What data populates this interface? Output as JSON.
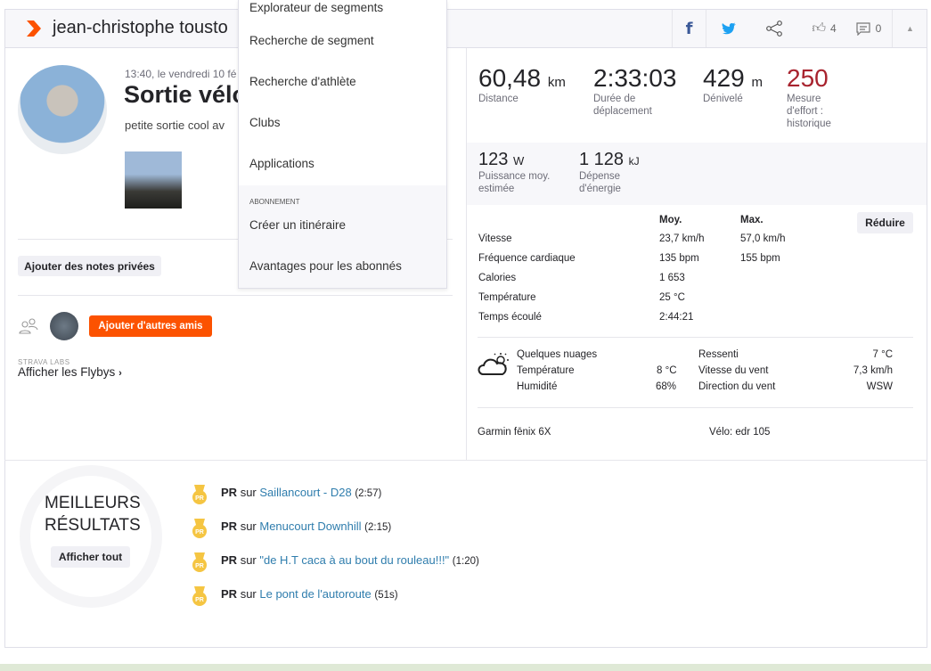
{
  "header": {
    "athlete_name": "jean-christophe tousto",
    "likes": "4",
    "comments": "0"
  },
  "menu": {
    "items": [
      "Explorateur de segments",
      "Recherche de segment",
      "Recherche d'athlète",
      "Clubs",
      "Applications"
    ],
    "section_label": "ABONNEMENT",
    "sub_items": [
      "Créer un itinéraire",
      "Avantages pour les abonnés"
    ]
  },
  "activity": {
    "datetime": "13:40, le vendredi 10 fé",
    "title": "Sortie vélo",
    "description": "petite sortie cool av",
    "private_notes_button": "Ajouter des notes privées",
    "add_friends_button": "Ajouter d'autres amis",
    "labs_label": "STRAVA LABS",
    "flybys_link": "Afficher les Flybys"
  },
  "stats": {
    "primary": [
      {
        "value": "60,48",
        "unit": "km",
        "label": "Distance"
      },
      {
        "value": "2:33:03",
        "unit": "",
        "label": "Durée de déplacement"
      },
      {
        "value": "429",
        "unit": "m",
        "label": "Dénivelé"
      },
      {
        "value": "250",
        "unit": "",
        "label": "Mesure d'effort : historique"
      }
    ],
    "secondary": [
      {
        "value": "123",
        "unit": "W",
        "label": "Puissance moy. estimée"
      },
      {
        "value": "1 128",
        "unit": "kJ",
        "label": "Dépense d'énergie"
      }
    ],
    "table_headers": [
      "Moy.",
      "Max."
    ],
    "reduce_button": "Réduire",
    "rows": [
      {
        "label": "Vitesse",
        "avg": "23,7 km/h",
        "max": "57,0 km/h"
      },
      {
        "label": "Fréquence cardiaque",
        "avg": "135 bpm",
        "max": "155 bpm"
      },
      {
        "label": "Calories",
        "avg": "1 653",
        "max": ""
      },
      {
        "label": "Température",
        "avg": "25 °C",
        "max": ""
      },
      {
        "label": "Temps écoulé",
        "avg": "2:44:21",
        "max": ""
      }
    ]
  },
  "weather": {
    "condition": "Quelques nuages",
    "temp_label": "Température",
    "temp": "8 °C",
    "humidity_label": "Humidité",
    "humidity": "68%",
    "feels_label": "Ressenti",
    "feels": "7 °C",
    "wind_speed_label": "Vitesse du vent",
    "wind_speed": "7,3 km/h",
    "wind_dir_label": "Direction du vent",
    "wind_dir": "WSW"
  },
  "device": {
    "device": "Garmin fēnix 6X",
    "bike": "Vélo: edr 105"
  },
  "results": {
    "title_1": "MEILLEURS",
    "title_2": "RÉSULTATS",
    "show_all": "Afficher tout",
    "pr_label": "PR",
    "sur": "sur",
    "items": [
      {
        "segment": "Saillancourt - D28",
        "time": "(2:57)"
      },
      {
        "segment": "Menucourt Downhill",
        "time": "(2:15)"
      },
      {
        "segment": "\"de H.T caca à au bout du rouleau!!!\"",
        "time": "(1:20)"
      },
      {
        "segment": "Le pont de l'autoroute",
        "time": "(51s)"
      }
    ]
  },
  "colors": {
    "brand": "#fc5200",
    "effort": "#a8232e",
    "link": "#2f7dad",
    "medal": "#f5c542"
  }
}
